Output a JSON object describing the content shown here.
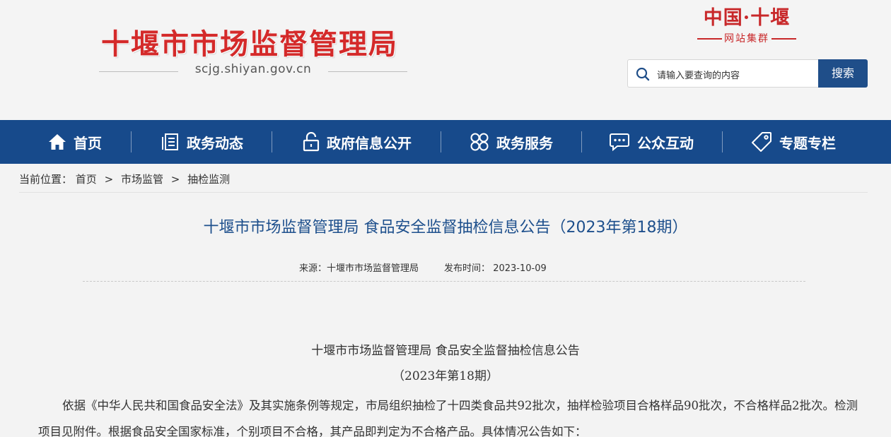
{
  "header": {
    "site_title": "十堰市市场监督管理局",
    "site_url": "scjg.shiyan.gov.cn",
    "group_logo_main": "中国·十堰",
    "group_logo_sub": "网站集群",
    "search_placeholder": "请输入要查询的内容",
    "search_button": "搜索"
  },
  "nav": {
    "items": [
      {
        "label": "首页",
        "icon": "home-icon"
      },
      {
        "label": "政务动态",
        "icon": "document-icon"
      },
      {
        "label": "政府信息公开",
        "icon": "lock-icon"
      },
      {
        "label": "政务服务",
        "icon": "grid-icon"
      },
      {
        "label": "公众互动",
        "icon": "chat-icon"
      },
      {
        "label": "专题专栏",
        "icon": "tag-icon"
      }
    ]
  },
  "breadcrumb": {
    "prefix": "当前位置：",
    "items": [
      "首页",
      "市场监管",
      "抽检监测"
    ],
    "separator": ">"
  },
  "article": {
    "title": "十堰市市场监督管理局 食品安全监督抽检信息公告（2023年第18期）",
    "source_label": "来源：",
    "source": "十堰市市场监督管理局",
    "date_label": "发布时间：",
    "date": "2023-10-09",
    "heading": "十堰市市场监督管理局 食品安全监督抽检信息公告",
    "subheading": "（2023年第18期）",
    "paragraph": "依据《中华人民共和国食品安全法》及其实施条例等规定，市局组织抽检了十四类食品共92批次，抽样检验项目合格样品90批次，不合格样品2批次。检测项目见附件。根据食品安全国家标准，个别项目不合格，其产品即判定为不合格产品。具体情况公告如下："
  },
  "colors": {
    "brand_red": "#d42a2a",
    "nav_blue": "#174a8b",
    "title_blue": "#1d4f8c"
  }
}
